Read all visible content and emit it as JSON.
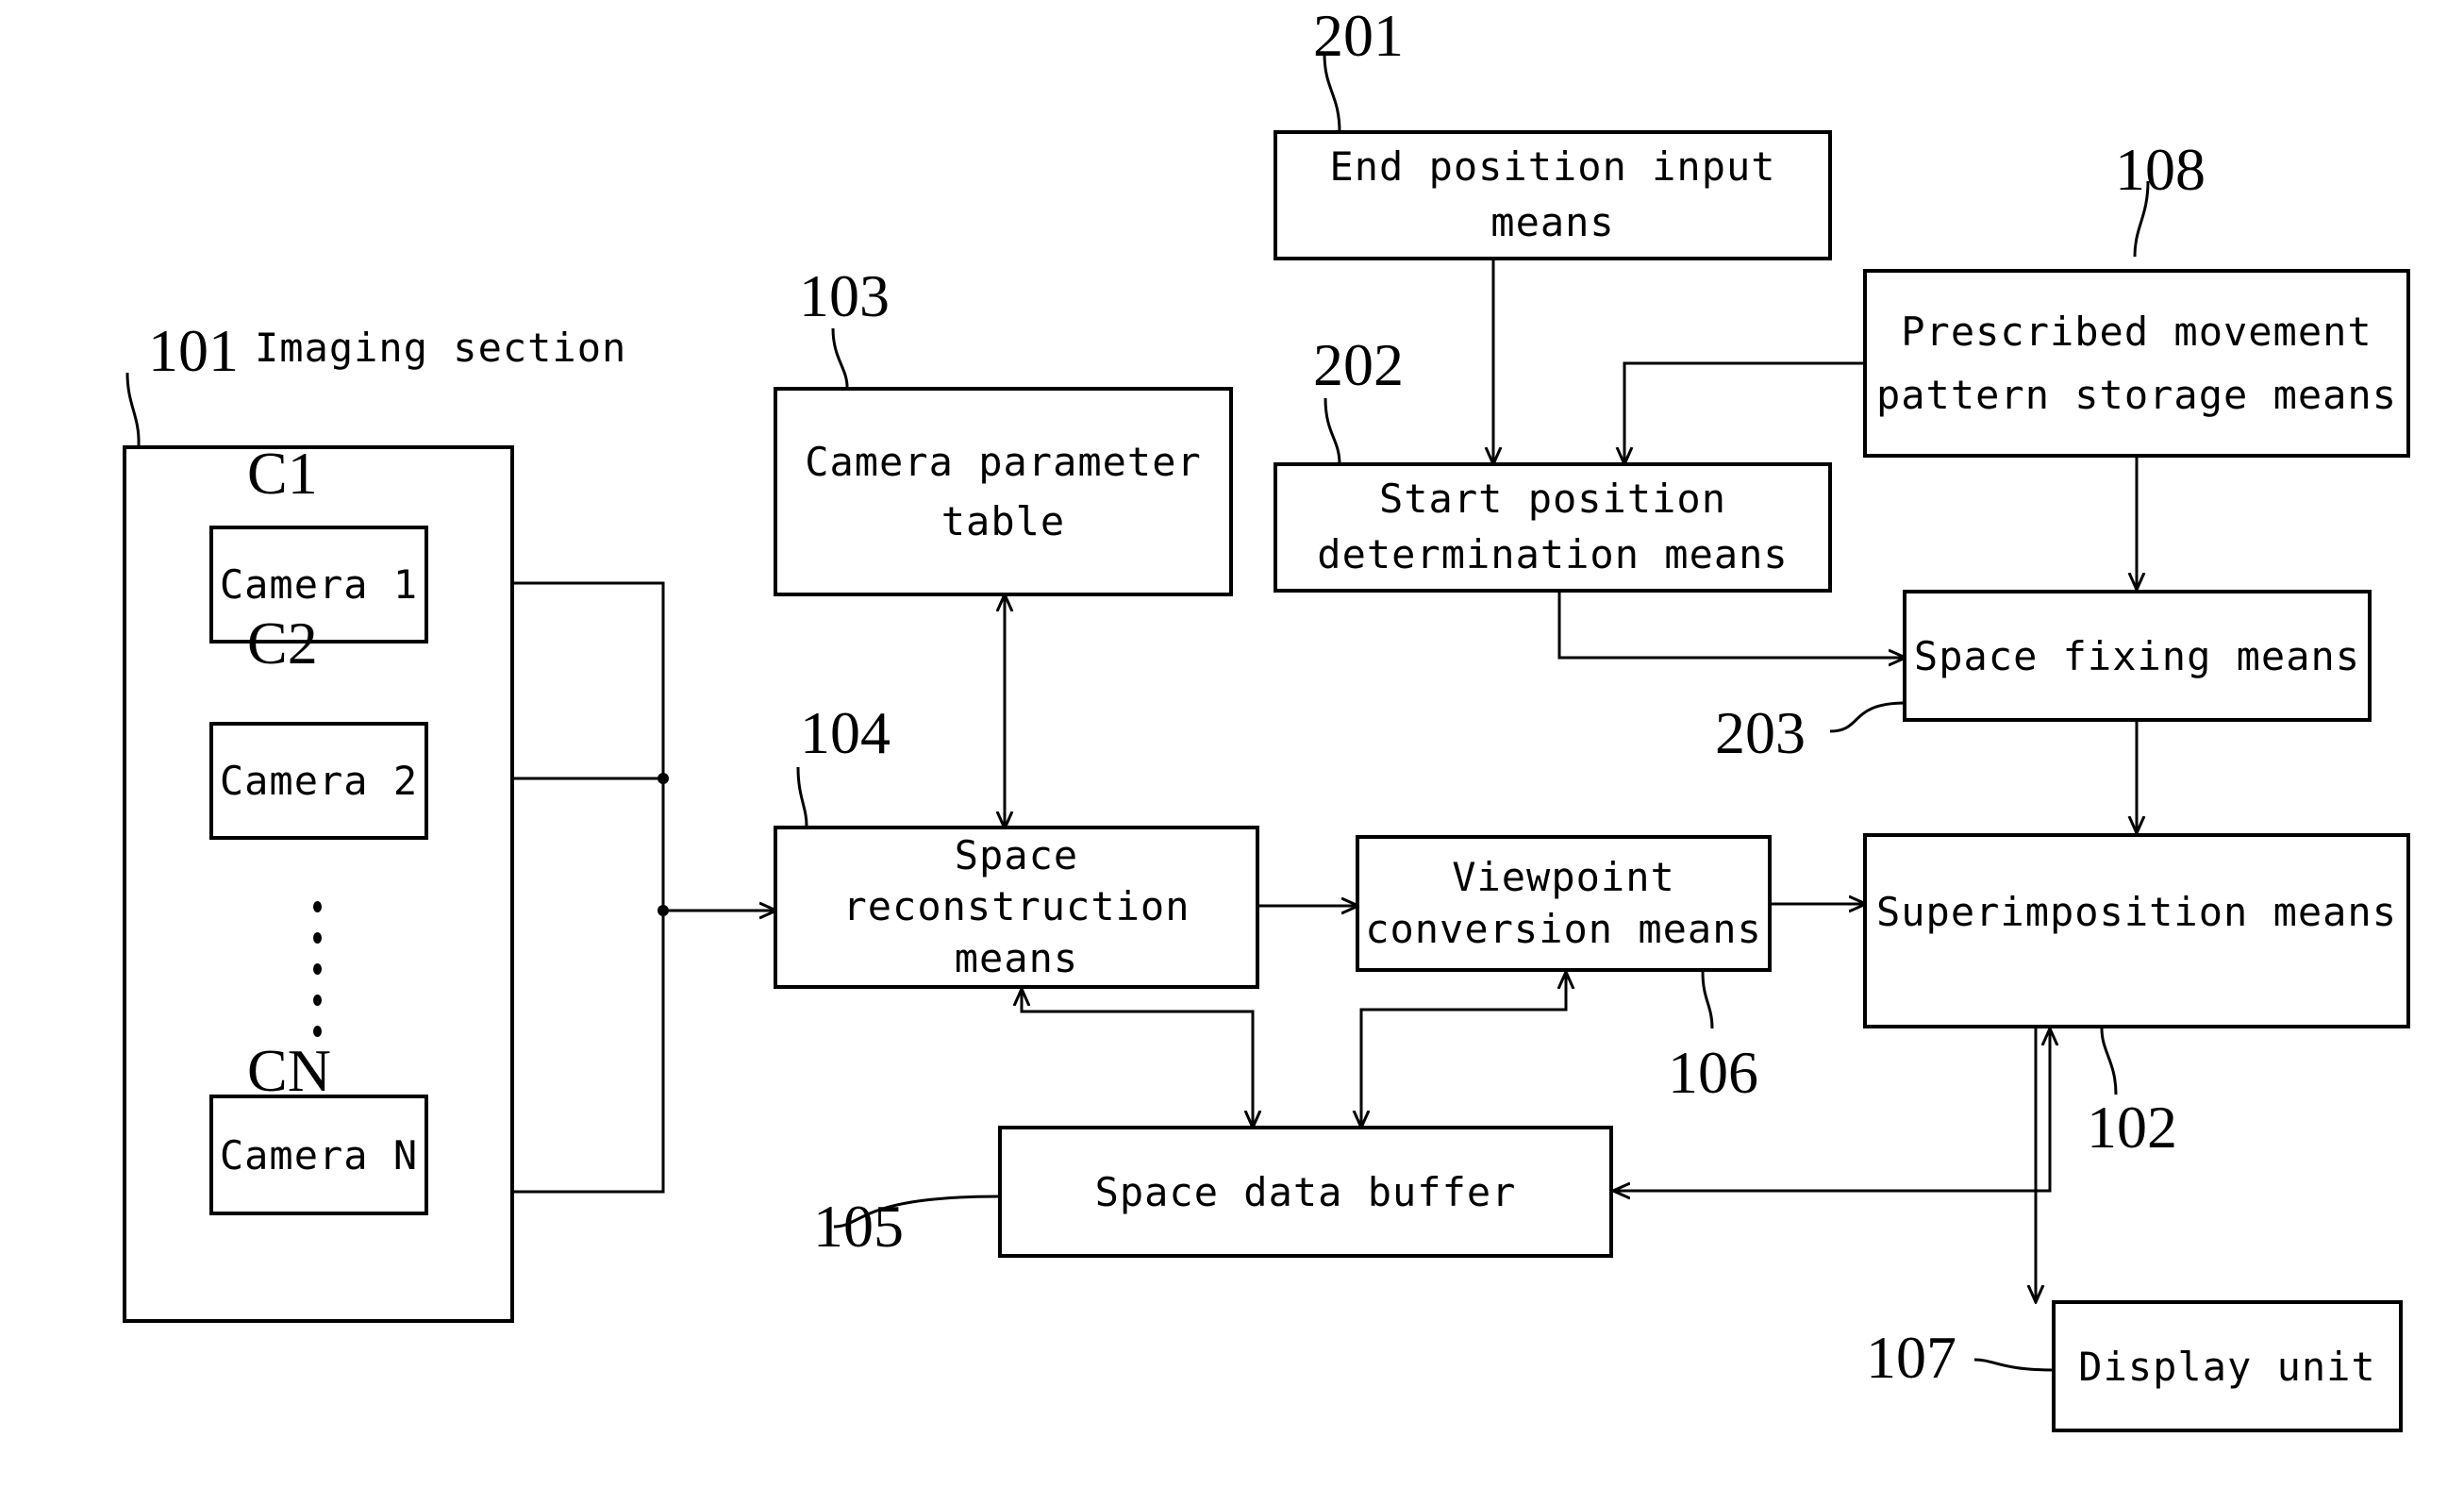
{
  "diagram": {
    "type": "block-diagram",
    "colors": {
      "stroke": "#000000",
      "background": "#ffffff"
    },
    "imaging_section": {
      "ref": "101",
      "caption": "Imaging section",
      "cameras": [
        {
          "ref": "C1",
          "label": "Camera 1"
        },
        {
          "ref": "C2",
          "label": "Camera 2"
        },
        {
          "ref": "CN",
          "label": "Camera N"
        }
      ]
    },
    "blocks": {
      "camera_parameter_table": {
        "ref": "103",
        "label": "Camera parameter\ntable"
      },
      "space_reconstruction": {
        "ref": "104",
        "label": "Space\nreconstruction\nmeans"
      },
      "space_data_buffer": {
        "ref": "105",
        "label": "Space data buffer"
      },
      "viewpoint_conversion": {
        "ref": "106",
        "label": "Viewpoint\nconversion means"
      },
      "end_position_input": {
        "ref": "201",
        "label": "End position input\nmeans"
      },
      "start_position_determination": {
        "ref": "202",
        "label": "Start position\ndetermination means"
      },
      "prescribed_movement_pattern_storage": {
        "ref": "108",
        "label": "Prescribed movement\npattern storage means"
      },
      "space_fixing": {
        "ref": "203",
        "label": "Space fixing means"
      },
      "superimposition": {
        "ref": "102",
        "label": "Superimposition means"
      },
      "display_unit": {
        "ref": "107",
        "label": "Display unit"
      }
    },
    "connections": [
      {
        "from": "Camera 1",
        "to": "Space reconstruction means",
        "type": "arrow"
      },
      {
        "from": "Camera 2",
        "to": "Space reconstruction means",
        "type": "arrow"
      },
      {
        "from": "Camera N",
        "to": "Space reconstruction means",
        "type": "arrow"
      },
      {
        "from": "Space reconstruction means",
        "to": "Camera parameter table",
        "type": "bidirectional"
      },
      {
        "from": "Space reconstruction means",
        "to": "Viewpoint conversion means",
        "type": "arrow"
      },
      {
        "from": "Space reconstruction means",
        "to": "Space data buffer",
        "type": "bidirectional"
      },
      {
        "from": "Viewpoint conversion means",
        "to": "Space data buffer",
        "type": "bidirectional"
      },
      {
        "from": "Viewpoint conversion means",
        "to": "Superimposition means",
        "type": "arrow"
      },
      {
        "from": "Superimposition means",
        "to": "Space data buffer",
        "type": "bidirectional"
      },
      {
        "from": "Superimposition means",
        "to": "Display unit",
        "type": "arrow"
      },
      {
        "from": "End position input means",
        "to": "Start position determination means",
        "type": "arrow"
      },
      {
        "from": "Prescribed movement pattern storage means",
        "to": "Start position determination means",
        "type": "arrow"
      },
      {
        "from": "Prescribed movement pattern storage means",
        "to": "Space fixing means",
        "type": "arrow"
      },
      {
        "from": "Start position determination means",
        "to": "Space fixing means",
        "type": "arrow"
      },
      {
        "from": "Space fixing means",
        "to": "Superimposition means",
        "type": "arrow"
      }
    ]
  }
}
